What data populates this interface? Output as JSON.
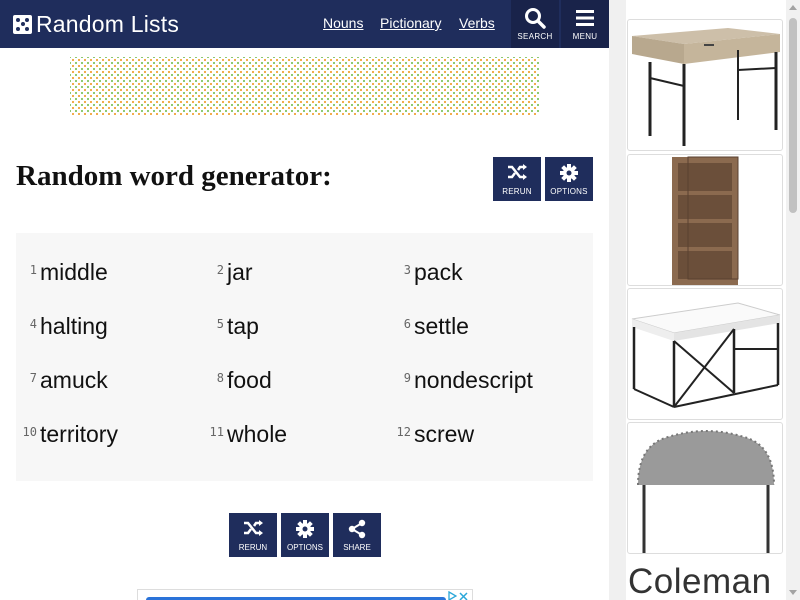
{
  "header": {
    "logo_text": "Random Lists",
    "nav": [
      "Nouns",
      "Pictionary",
      "Verbs"
    ],
    "search_label": "SEARCH",
    "menu_label": "MENU"
  },
  "main": {
    "title": "Random word generator:",
    "tools": {
      "rerun_label": "RERUN",
      "options_label": "OPTIONS"
    },
    "results": [
      {
        "num": "1",
        "word": "middle"
      },
      {
        "num": "2",
        "word": "jar"
      },
      {
        "num": "3",
        "word": "pack"
      },
      {
        "num": "4",
        "word": "halting"
      },
      {
        "num": "5",
        "word": "tap"
      },
      {
        "num": "6",
        "word": "settle"
      },
      {
        "num": "7",
        "word": "amuck"
      },
      {
        "num": "8",
        "word": "food"
      },
      {
        "num": "9",
        "word": "nondescript"
      },
      {
        "num": "10",
        "word": "territory"
      },
      {
        "num": "11",
        "word": "whole"
      },
      {
        "num": "12",
        "word": "screw"
      }
    ],
    "actions": {
      "rerun_label": "RERUN",
      "options_label": "OPTIONS",
      "share_label": "SHARE"
    }
  },
  "sidebar_ad": {
    "brand": "Coleman",
    "products": [
      "desk-image",
      "bookcase-image",
      "coffee-table-image",
      "headboard-image"
    ]
  },
  "colors": {
    "header": "#1f2d5c",
    "button": "#1f2d5c",
    "results_bg": "#f7f7f7"
  }
}
